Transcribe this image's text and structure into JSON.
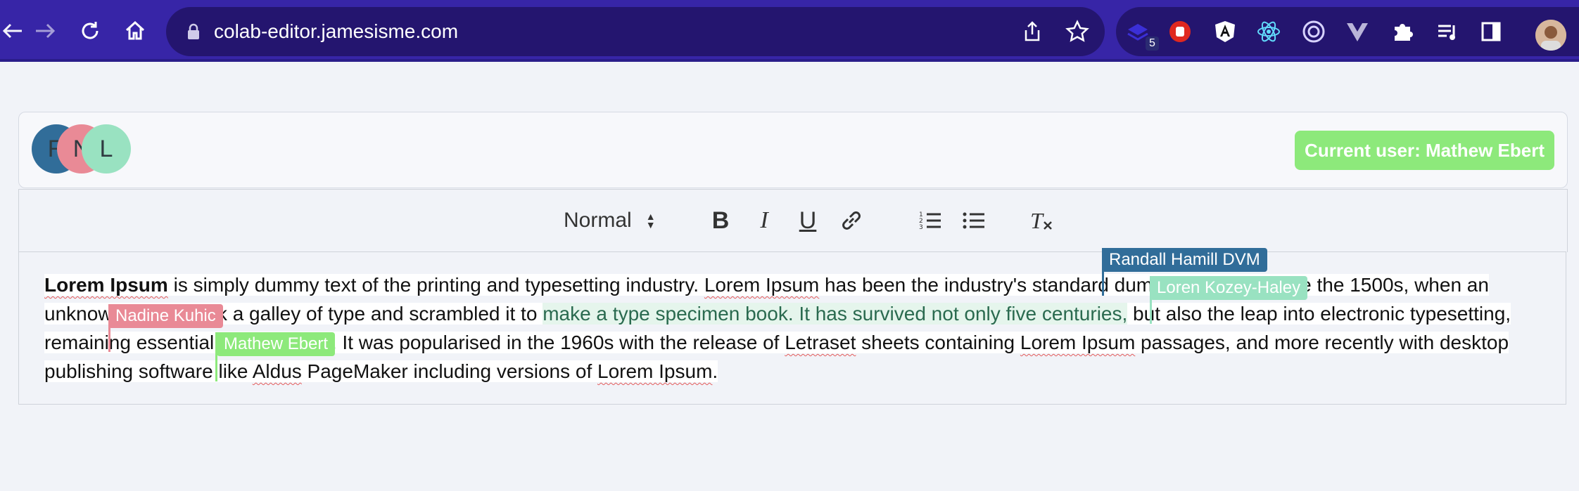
{
  "browser": {
    "url": "colab-editor.jamesisme.com",
    "extension_badge": "5"
  },
  "users": {
    "bubbles": [
      "R",
      "N",
      "L"
    ],
    "current_user_label": "Current user: Mathew Ebert"
  },
  "toolbar": {
    "format_select": "Normal",
    "bold_label": "B",
    "italic_label": "I",
    "underline_label": "U",
    "clear_label": "T"
  },
  "document": {
    "seg1_bold": "Lorem Ipsum",
    "seg2": " is simply dummy text of the printing and typesetting industry. ",
    "seg3_sq": "Lorem Ipsum",
    "seg4": " has been the industry's standard dummy text ever since the 1500s, when an unknown printer took a galley of type and scrambled it to ",
    "seg5_selected": "make a type specimen book. It has survived not only five centuries,",
    "seg6": " but also the leap into electronic typesetting, remaining essentially unchanged. It was popularised in the 1960s with the release of ",
    "seg7_sq": "Letraset",
    "seg8": " sheets containing ",
    "seg9_sq": "Lorem Ipsum",
    "seg10": " passages, and more recently with desktop publishing software like ",
    "seg11_sq": "Aldus",
    "seg12": " PageMaker including versions of ",
    "seg13_sq": "Lorem Ipsum",
    "seg14": "."
  },
  "cursors": {
    "randall": "Randall Hamill DVM",
    "loren": "Loren Kozey-Haley",
    "nadine": "Nadine Kuhic",
    "mathew": "Mathew Ebert"
  },
  "colors": {
    "chrome": "#3725a7",
    "randall": "#316d99",
    "loren": "#99e2c1",
    "nadine": "#e98a96",
    "mathew": "#8de97b"
  }
}
